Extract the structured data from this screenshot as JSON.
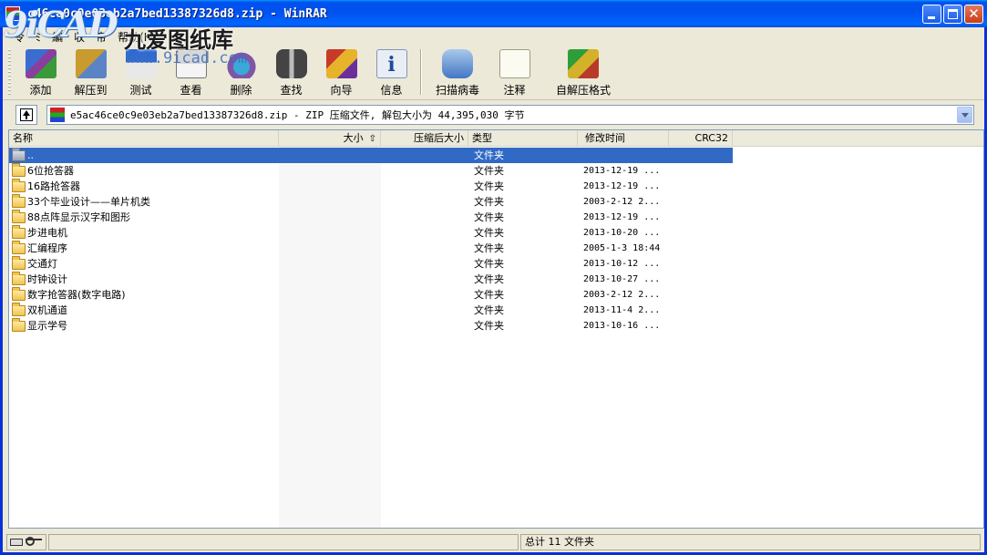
{
  "window": {
    "title": "e5ac46ce0c9e03eb2a7bed13387326d8.zip - WinRAR",
    "title_visible": "c46ce0c9e03eb2a7bed13387326d8.zip - WinRAR",
    "buttons": [
      "minimize",
      "maximize",
      "close"
    ]
  },
  "watermark": {
    "logo": "9iCAD",
    "cn": "九爱图纸库",
    "url": "www.9icad.com"
  },
  "menu": {
    "items": [
      {
        "label": "令"
      },
      {
        "label": "ﾐ"
      },
      {
        "label": "編"
      },
      {
        "label": "収"
      },
      {
        "label": "帝"
      },
      {
        "label": "帮助(H)"
      }
    ]
  },
  "toolbar": {
    "buttons": [
      {
        "label": "添加",
        "icon": "add-icon"
      },
      {
        "label": "解压到",
        "icon": "extract-icon"
      },
      {
        "label": "测试",
        "icon": "test-icon"
      },
      {
        "label": "查看",
        "icon": "view-icon"
      },
      {
        "label": "删除",
        "icon": "delete-icon"
      },
      {
        "label": "查找",
        "icon": "binoculars-icon"
      },
      {
        "label": "向导",
        "icon": "wizard-icon"
      },
      {
        "label": "信息",
        "icon": "info-icon"
      },
      {
        "label": "扫描病毒",
        "icon": "scan-virus-icon"
      },
      {
        "label": "注释",
        "icon": "comment-icon"
      },
      {
        "label": "自解压格式",
        "icon": "sfx-icon"
      }
    ]
  },
  "address": {
    "path": "e5ac46ce0c9e03eb2a7bed13387326d8.zip - ZIP 压缩文件, 解包大小为 44,395,030 字节"
  },
  "columns": {
    "name": "名称",
    "size": "大小",
    "packed": "压缩后大小",
    "type": "类型",
    "modified": "修改时间",
    "crc": "CRC32"
  },
  "files": [
    {
      "name": "..",
      "type": "文件夹",
      "modified": "",
      "selected": true,
      "up": true
    },
    {
      "name": "6位抢答器",
      "type": "文件夹",
      "modified": "2013-12-19 ..."
    },
    {
      "name": "16路抢答器",
      "type": "文件夹",
      "modified": "2013-12-19 ..."
    },
    {
      "name": "33个毕业设计——单片机类",
      "type": "文件夹",
      "modified": "2003-2-12 2..."
    },
    {
      "name": "88点阵显示汉字和图形",
      "type": "文件夹",
      "modified": "2013-12-19 ..."
    },
    {
      "name": "步进电机",
      "type": "文件夹",
      "modified": "2013-10-20 ..."
    },
    {
      "name": "汇编程序",
      "type": "文件夹",
      "modified": "2005-1-3 18:44"
    },
    {
      "name": "交通灯",
      "type": "文件夹",
      "modified": "2013-10-12 ..."
    },
    {
      "name": "时钟设计",
      "type": "文件夹",
      "modified": "2013-10-27 ..."
    },
    {
      "name": "数字抢答器(数字电路)",
      "type": "文件夹",
      "modified": "2003-2-12 2..."
    },
    {
      "name": "双机通道",
      "type": "文件夹",
      "modified": "2013-11-4 2..."
    },
    {
      "name": "显示学号",
      "type": "文件夹",
      "modified": "2013-10-16 ..."
    }
  ],
  "status": {
    "summary": "总计 11 文件夹"
  }
}
